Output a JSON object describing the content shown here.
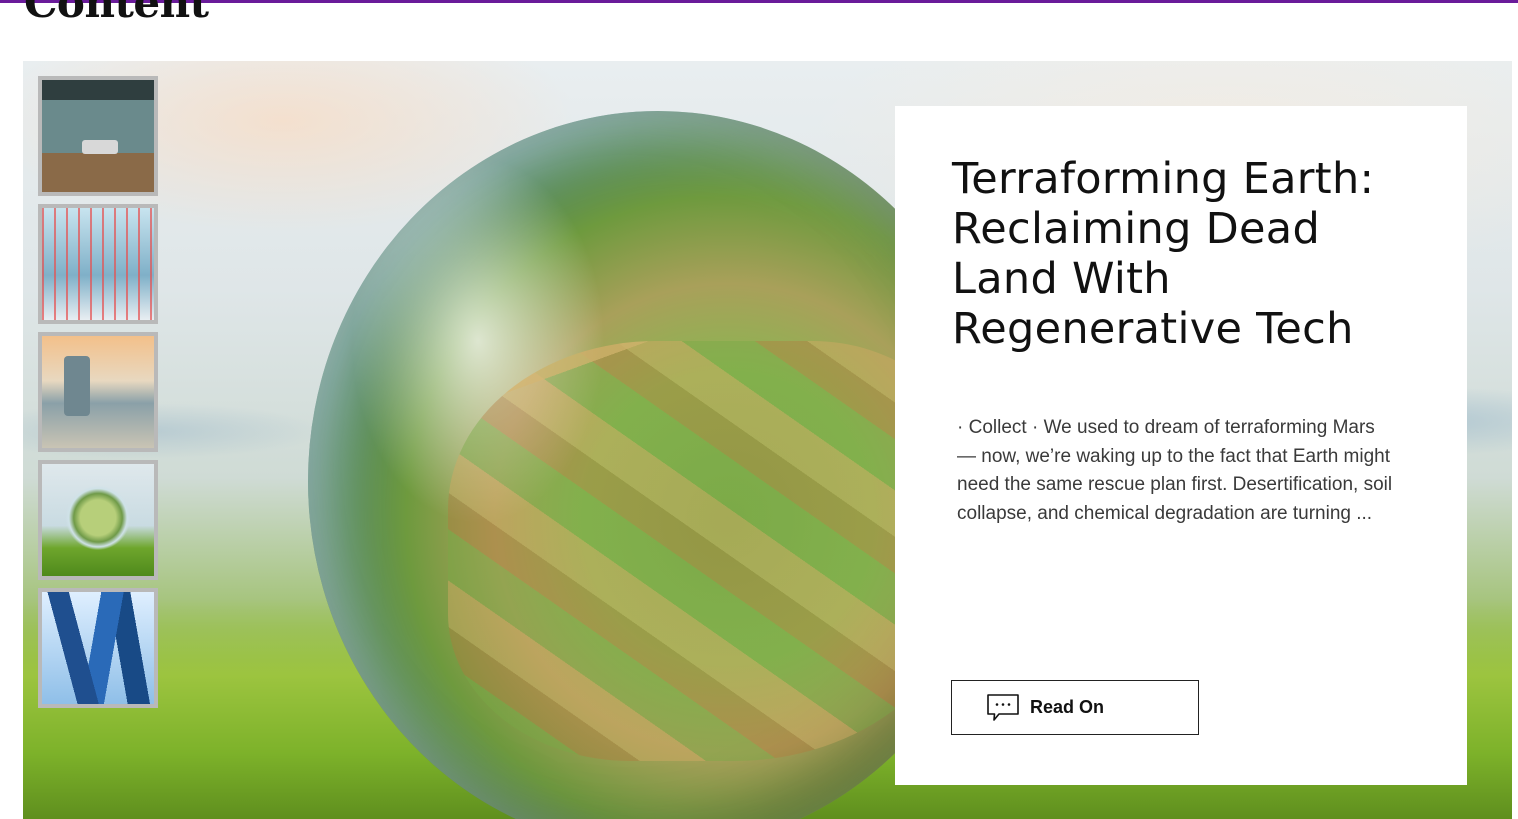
{
  "page": {
    "heading": "Content",
    "accent_color": "#6a1b9a"
  },
  "gallery": {
    "thumbnails": [
      {
        "icon": "treatment-room-image"
      },
      {
        "icon": "dna-lab-image"
      },
      {
        "icon": "machinery-image"
      },
      {
        "icon": "glass-globe-image"
      },
      {
        "icon": "glass-towers-image"
      }
    ]
  },
  "featured": {
    "title": "Terraforming Earth: Reclaiming Dead Land With Regenerative Tech",
    "excerpt": "· Collect · We used to dream of terraforming Mars — now, we’re waking up to the fact that Earth might need the same rescue plan first. Desertification, soil collapse, and chemical degradation are turning ...",
    "button_label": "Read On",
    "button_icon": "comment-bubble-icon"
  }
}
